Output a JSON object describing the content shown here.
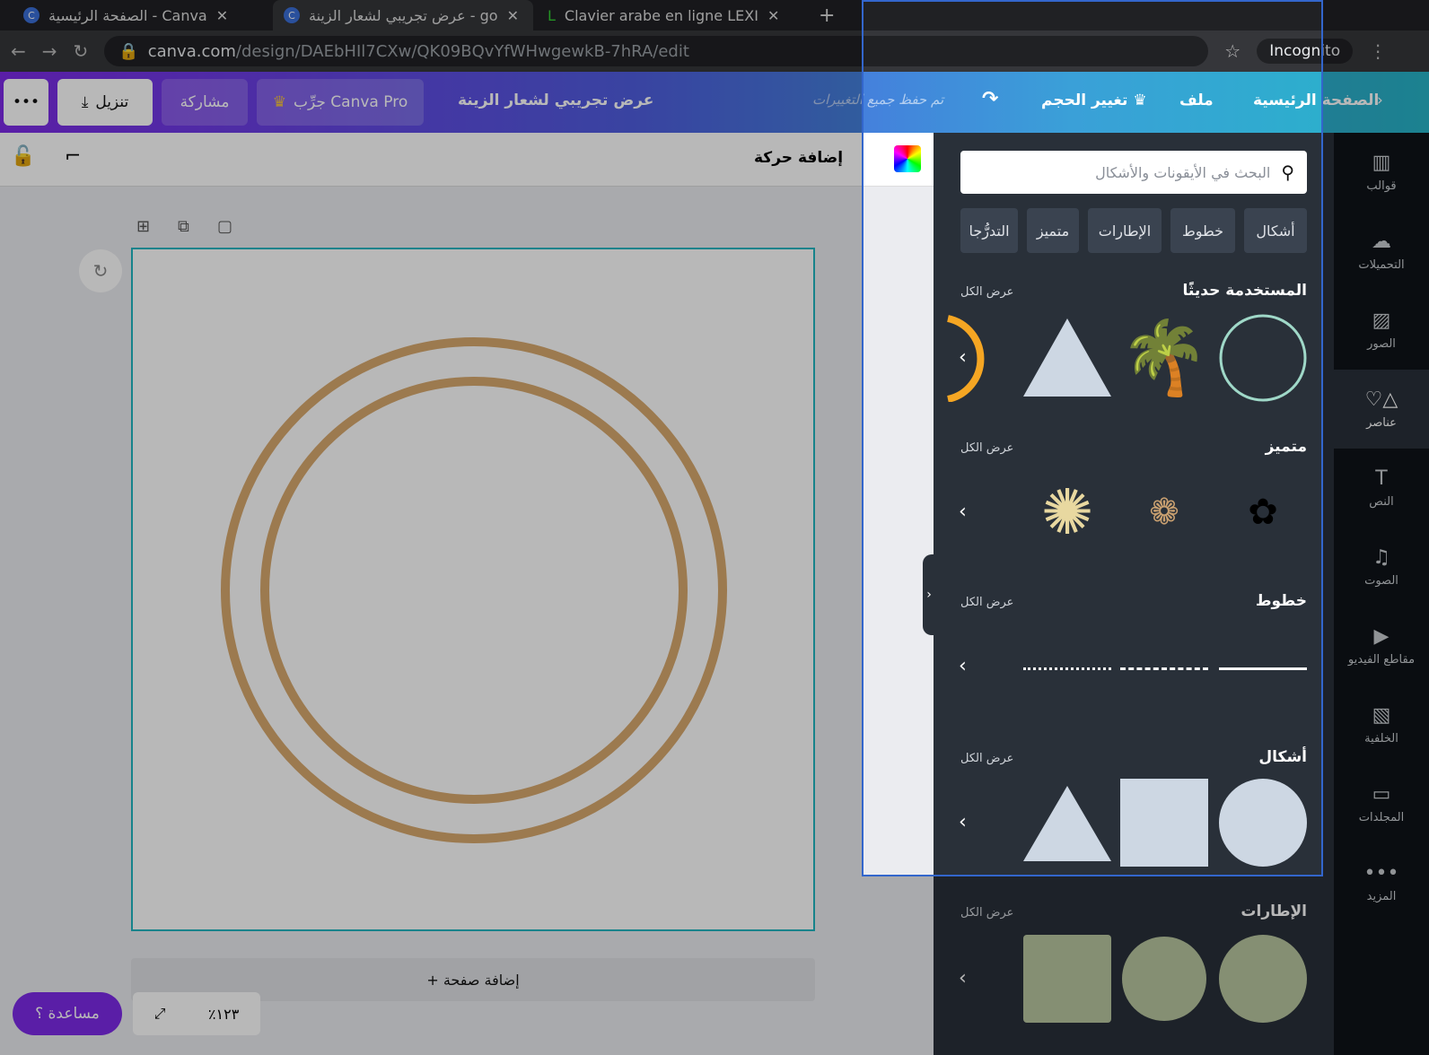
{
  "browser": {
    "tabs": [
      {
        "title": "الصفحة الرئيسية - Canva"
      },
      {
        "title": "عرض تجريبي لشعار الزينة - go"
      },
      {
        "title": "Clavier arabe en ligne LEXI"
      }
    ],
    "url_domain": "canva.com",
    "url_path": "/design/DAEbHIl7CXw/QK09BQvYfWHwgewkB-7hRA/edit",
    "incognito_label": "Incognito"
  },
  "header": {
    "home": "الصفحة الرئيسية",
    "file": "ملف",
    "resize": "تغيير الحجم",
    "saved": "تم حفظ جميع التغييرات",
    "title": "عرض تجريبي لشعار الزينة",
    "try_pro": "جرِّب Canva Pro",
    "share": "مشاركة",
    "download": "تنزيل",
    "more": "•••"
  },
  "toolbar": {
    "animate": "إضافة حركة"
  },
  "canvas": {
    "add_page": "+ إضافة صفحة",
    "zoom": "٪١٢٣",
    "help": "مساعدة ؟"
  },
  "panel": {
    "search_placeholder": "البحث في الأيقونات والأشكال",
    "chips": [
      "أشكال",
      "خطوط",
      "الإطارات",
      "متميز",
      "التدرُّجا"
    ],
    "sections": [
      {
        "title": "المستخدمة حديثًا",
        "see_all": "عرض الكل"
      },
      {
        "title": "متميز",
        "see_all": "عرض الكل"
      },
      {
        "title": "خطوط",
        "see_all": "عرض الكل"
      },
      {
        "title": "أشكال",
        "see_all": "عرض الكل"
      },
      {
        "title": "الإطارات",
        "see_all": "عرض الكل"
      }
    ]
  },
  "rail": [
    {
      "label": "قوالب",
      "icon": "▥"
    },
    {
      "label": "التحميلات",
      "icon": "☁"
    },
    {
      "label": "الصور",
      "icon": "▨"
    },
    {
      "label": "عناصر",
      "icon": "♡△"
    },
    {
      "label": "النص",
      "icon": "T"
    },
    {
      "label": "الصوت",
      "icon": "♫"
    },
    {
      "label": "مقاطع الفيديو",
      "icon": "▶"
    },
    {
      "label": "الخلفية",
      "icon": "▧"
    },
    {
      "label": "المجلدات",
      "icon": "▭"
    },
    {
      "label": "المزيد",
      "icon": "•••"
    }
  ],
  "colors": {
    "accent": "#7d2ae8",
    "ring": "#c9a070",
    "selection": "#1fb6c1"
  }
}
